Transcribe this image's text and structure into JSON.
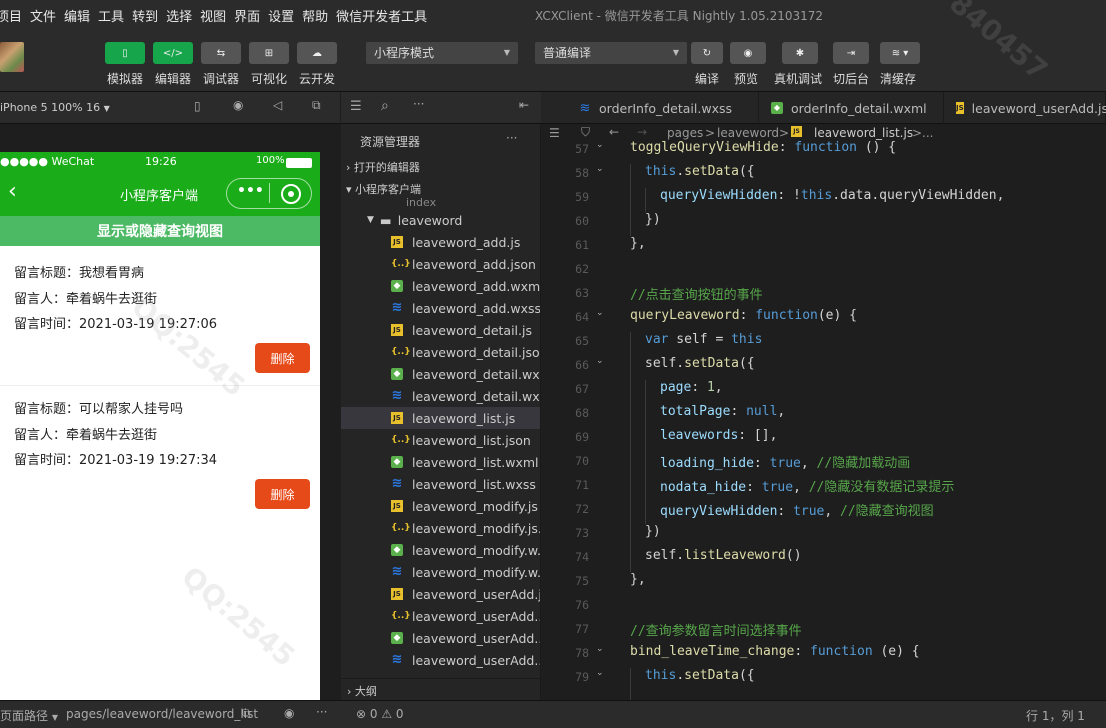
{
  "menubar": {
    "items": [
      "项目",
      "文件",
      "编辑",
      "工具",
      "转到",
      "选择",
      "视图",
      "界面",
      "设置",
      "帮助",
      "微信开发者工具"
    ],
    "title": "XCXClient - 微信开发者工具 Nightly 1.05.2103172"
  },
  "toolbar": {
    "simulator": "模拟器",
    "editor": "编辑器",
    "debugger": "调试器",
    "visual": "可视化",
    "cloud": "云开发",
    "mode": "小程序模式",
    "compile": "普通编译",
    "compile_btn": "编译",
    "preview": "预览",
    "realdebug": "真机调试",
    "background": "切后台",
    "clearcache": "清缓存"
  },
  "simulator": {
    "device": "iPhone 5 100% 16",
    "status": {
      "carrier": "●●●●● WeChat",
      "time": "19:26",
      "battery": "100%"
    },
    "nav_title": "小程序客户端",
    "toggle_label": "显示或隐藏查询视图",
    "messages": [
      {
        "title": "留言标题：我想看胃病",
        "author": "留言人：牵着蜗牛去逛街",
        "time": "留言时间：2021-03-19 19:27:06",
        "delete": "删除"
      },
      {
        "title": "留言标题：可以帮家人挂号吗",
        "author": "留言人：牵着蜗牛去逛街",
        "time": "留言时间：2021-03-19 19:27:34",
        "delete": "删除"
      }
    ]
  },
  "explorer": {
    "title": "资源管理器",
    "open_editors": "打开的编辑器",
    "project": "小程序客户端",
    "partial": "index",
    "folder": "leaveword",
    "outline": "大纲",
    "files": [
      {
        "name": "leaveword_add.js",
        "type": "js"
      },
      {
        "name": "leaveword_add.json",
        "type": "json"
      },
      {
        "name": "leaveword_add.wxml",
        "type": "wxml"
      },
      {
        "name": "leaveword_add.wxss",
        "type": "wxss"
      },
      {
        "name": "leaveword_detail.js",
        "type": "js"
      },
      {
        "name": "leaveword_detail.json",
        "type": "json"
      },
      {
        "name": "leaveword_detail.wx...",
        "type": "wxml"
      },
      {
        "name": "leaveword_detail.wxss",
        "type": "wxss"
      },
      {
        "name": "leaveword_list.js",
        "type": "js",
        "selected": true
      },
      {
        "name": "leaveword_list.json",
        "type": "json"
      },
      {
        "name": "leaveword_list.wxml",
        "type": "wxml"
      },
      {
        "name": "leaveword_list.wxss",
        "type": "wxss"
      },
      {
        "name": "leaveword_modify.js",
        "type": "js"
      },
      {
        "name": "leaveword_modify.js...",
        "type": "json"
      },
      {
        "name": "leaveword_modify.w...",
        "type": "wxml"
      },
      {
        "name": "leaveword_modify.w...",
        "type": "wxss"
      },
      {
        "name": "leaveword_userAdd.js",
        "type": "js"
      },
      {
        "name": "leaveword_userAdd....",
        "type": "json"
      },
      {
        "name": "leaveword_userAdd....",
        "type": "wxml"
      },
      {
        "name": "leaveword_userAdd....",
        "type": "wxss"
      }
    ]
  },
  "editor": {
    "tabs": [
      {
        "name": "orderInfo_detail.wxss",
        "type": "wxss"
      },
      {
        "name": "orderInfo_detail.wxml",
        "type": "wxml"
      },
      {
        "name": "leaveword_userAdd.js",
        "type": "js"
      }
    ],
    "breadcrumb": [
      "pages",
      ">",
      "leaveword",
      ">",
      "leaveword_list.js",
      ">",
      "..."
    ],
    "line_numbers": [
      "57",
      "58",
      "59",
      "60",
      "61",
      "62",
      "63",
      "64",
      "65",
      "66",
      "67",
      "68",
      "69",
      "70",
      "71",
      "72",
      "73",
      "74",
      "75",
      "76",
      "77",
      "78",
      "79"
    ]
  },
  "bottombar": {
    "path_label": "页面路径",
    "path": "pages/leaveword/leaveword_list",
    "problems": "⊗ 0 ⚠ 0",
    "cursor": "行 1，列 1"
  },
  "colors": {
    "wechat_green": "#1aad19",
    "toolbar_green": "#17a54c",
    "delete_orange": "#e64a19",
    "toggle_green": "#4cb964"
  }
}
